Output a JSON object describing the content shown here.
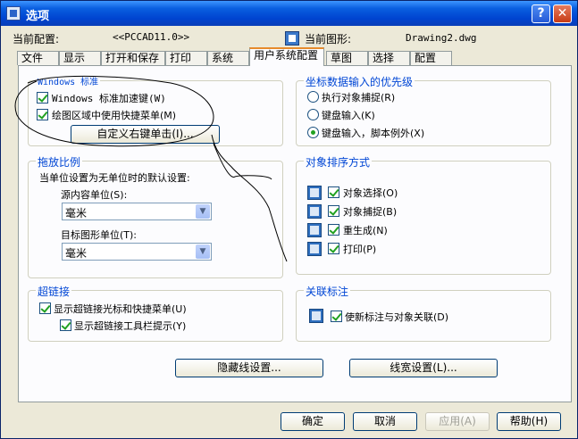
{
  "window": {
    "title": "选项",
    "help_btn": "?",
    "close_btn": "✕"
  },
  "header": {
    "current_profile_label": "当前配置:",
    "current_profile_value": "<<PCCAD11.0>>",
    "current_drawing_label": "当前图形:",
    "current_drawing_value": "Drawing2.dwg"
  },
  "tabs": [
    "文件",
    "显示",
    "打开和保存",
    "打印",
    "系统",
    "用户系统配置",
    "草图",
    "选择",
    "配置"
  ],
  "windows_standard": {
    "title": "Windows 标准",
    "accel_keys": "Windows 标准加速键(W)",
    "shortcut_menus": "绘图区域中使用快捷菜单(M)",
    "right_click_btn": "自定义右键单击(I)..."
  },
  "coord_input": {
    "title": "坐标数据输入的优先级",
    "options": [
      "执行对象捕捉(R)",
      "键盘输入(K)",
      "键盘输入，脚本例外(X)"
    ],
    "selected_index": 2
  },
  "scale": {
    "title": "拖放比例",
    "desc": "当单位设置为无单位时的默认设置:",
    "source_label": "源内容单位(S):",
    "source_value": "毫米",
    "target_label": "目标图形单位(T):",
    "target_value": "毫米"
  },
  "sorting": {
    "title": "对象排序方式",
    "items": [
      "对象选择(O)",
      "对象捕捉(B)",
      "重生成(N)",
      "打印(P)"
    ]
  },
  "hyperlink": {
    "title": "超链接",
    "cursor_menu": "显示超链接光标和快捷菜单(U)",
    "tooltip": "显示超链接工具栏提示(Y)"
  },
  "associative": {
    "title": "关联标注",
    "make_assoc": "使新标注与对象关联(D)"
  },
  "buttons": {
    "hidden_line": "隐藏线设置...",
    "lineweight": "线宽设置(L)...",
    "ok": "确定",
    "cancel": "取消",
    "apply": "应用(A)",
    "help": "帮助(H)"
  }
}
